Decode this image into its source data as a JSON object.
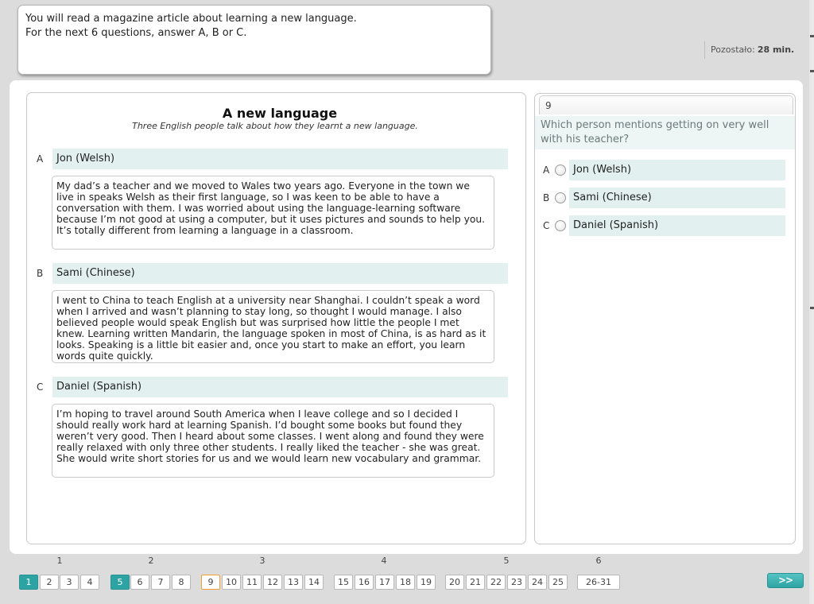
{
  "instructions": {
    "line1": "You will read a magazine article about learning a new language.",
    "line2": "For the next 6 questions, answer A, B or C."
  },
  "timer": {
    "label": "Pozostało:",
    "value": "28 min."
  },
  "article": {
    "title": "A new language",
    "subtitle": "Three English people talk about how they learnt a new language.",
    "people": [
      {
        "letter": "A",
        "name": "Jon (Welsh)",
        "text": "My dad’s a teacher and we moved to Wales two years ago. Everyone in the town we live in speaks Welsh as their first language, so I was keen to be able to have a conversation with them. I was worried about using the language-learning software because I’m not good at using a computer, but it uses pictures and sounds to help you. It’s totally different from learning a language in a classroom."
      },
      {
        "letter": "B",
        "name": "Sami (Chinese)",
        "text": "I went to China to teach English at a university near Shanghai. I couldn’t speak a word when I arrived and wasn’t planning to stay long, so thought I would manage. I also believed people would speak English but was surprised how little the people I met knew. Learning written Mandarin, the language spoken in most of China, is as hard as it looks. Speaking is a little bit easier and, once you start to make an effort, you learn words quite quickly."
      },
      {
        "letter": "C",
        "name": "Daniel (Spanish)",
        "text": "I’m hoping to travel around South America when I leave college and so I decided I should really work hard at learning Spanish. I’d bought some books but found they weren’t very good. Then I heard about some classes. I went along and found they were really relaxed with only three other students. I really liked the teacher - she was great. She would write short stories for us and we would learn new vocabulary and grammar."
      }
    ]
  },
  "question": {
    "number": "9",
    "text": "Which person mentions getting on very well with his teacher?",
    "options": [
      {
        "letter": "A",
        "label": "Jon (Welsh)"
      },
      {
        "letter": "B",
        "label": "Sami (Chinese)"
      },
      {
        "letter": "C",
        "label": "Daniel (Spanish)"
      }
    ]
  },
  "navigation": {
    "groups": [
      "1",
      "2",
      "3",
      "4",
      "5",
      "6"
    ],
    "pages": [
      "1",
      "2",
      "3",
      "4",
      "5",
      "6",
      "7",
      "8",
      "9",
      "10",
      "11",
      "12",
      "13",
      "14",
      "15",
      "16",
      "17",
      "18",
      "19",
      "20",
      "21",
      "22",
      "23",
      "24",
      "25",
      "26-31"
    ],
    "answered": [
      "1",
      "5"
    ],
    "current": "9",
    "next_label": ">>",
    "answered_color": "#2ea3a3",
    "current_color": "#f0a030"
  }
}
